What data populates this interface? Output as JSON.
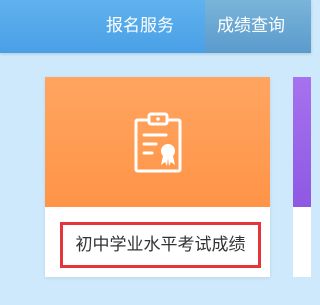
{
  "nav": {
    "items": [
      {
        "label": "报名服务"
      },
      {
        "label": "成绩查询"
      }
    ]
  },
  "card": {
    "label": "初中学业水平考试成绩",
    "icon": "clipboard-certificate-icon",
    "top_color": "#ff9d55",
    "highlight_color": "#e4353b"
  },
  "next_card": {
    "color": "#9a63e8"
  }
}
